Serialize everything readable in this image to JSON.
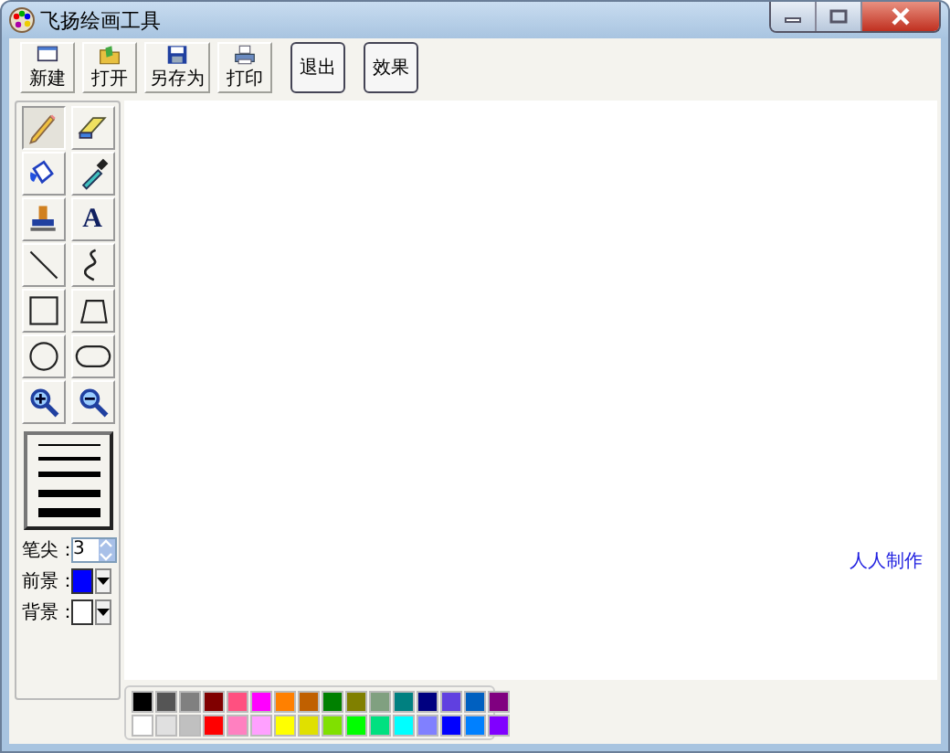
{
  "window": {
    "title": "飞扬绘画工具"
  },
  "toolbar": [
    {
      "kind": "new",
      "label": "新建"
    },
    {
      "kind": "open",
      "label": "打开"
    },
    {
      "kind": "save",
      "label": "另存为"
    },
    {
      "kind": "print",
      "label": "打印"
    },
    {
      "kind": "text",
      "label": "退出"
    },
    {
      "kind": "text",
      "label": "效果"
    }
  ],
  "tools": [
    {
      "kind": "pencil",
      "selected": true
    },
    {
      "kind": "eraser",
      "selected": false
    },
    {
      "kind": "fill",
      "selected": false
    },
    {
      "kind": "picker",
      "selected": false
    },
    {
      "kind": "stamp",
      "selected": false
    },
    {
      "kind": "text",
      "selected": false,
      "label": "A"
    },
    {
      "kind": "line",
      "selected": false
    },
    {
      "kind": "curve",
      "selected": false
    },
    {
      "kind": "rect",
      "selected": false
    },
    {
      "kind": "polygon",
      "selected": false
    },
    {
      "kind": "ellipse",
      "selected": false
    },
    {
      "kind": "roundrect",
      "selected": false
    },
    {
      "kind": "zoomin",
      "selected": false
    },
    {
      "kind": "zoomout",
      "selected": false
    }
  ],
  "settings": {
    "tip": {
      "label": "笔尖：",
      "value": "3"
    },
    "foreground": {
      "label": "前景：",
      "color": "#0000ff"
    },
    "background": {
      "label": "背景：",
      "color": "#ffffff"
    }
  },
  "canvas": {
    "caption": "人人制作"
  },
  "palette": [
    {
      "color": "#000000"
    },
    {
      "color": "#555555"
    },
    {
      "color": "#808080"
    },
    {
      "color": "#800000"
    },
    {
      "color": "#ff5080"
    },
    {
      "color": "#ff00ff"
    },
    {
      "color": "#ff8000"
    },
    {
      "color": "#c06000"
    },
    {
      "color": "#008000"
    },
    {
      "color": "#808000"
    },
    {
      "color": "#80a080"
    },
    {
      "color": "#008080"
    },
    {
      "color": "#000080"
    },
    {
      "color": "#6040e0"
    },
    {
      "color": "#0060c0"
    },
    {
      "color": "#800080"
    },
    {
      "color": "#ffffff"
    },
    {
      "color": "#e0e0e0"
    },
    {
      "color": "#c0c0c0"
    },
    {
      "color": "#ff0000"
    },
    {
      "color": "#ff80c0"
    },
    {
      "color": "#ffa0ff"
    },
    {
      "color": "#ffff00"
    },
    {
      "color": "#e0e000"
    },
    {
      "color": "#80e000"
    },
    {
      "color": "#00ff00"
    },
    {
      "color": "#00e080"
    },
    {
      "color": "#00ffff"
    },
    {
      "color": "#8080ff"
    },
    {
      "color": "#0000ff"
    },
    {
      "color": "#0080ff"
    },
    {
      "color": "#8000ff"
    }
  ]
}
